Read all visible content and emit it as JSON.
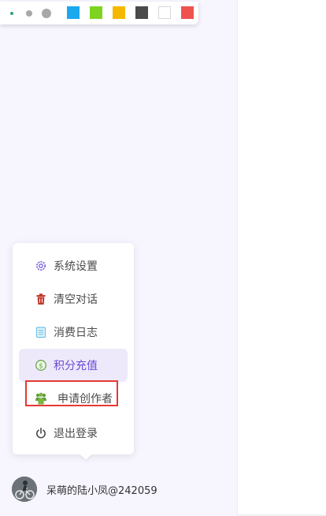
{
  "toolbar": {
    "sizes": [
      "small",
      "medium",
      "large"
    ],
    "colors": [
      "#1aa8ef",
      "#7ed321",
      "#f5b800",
      "#4a4a4a",
      "#ffffff",
      "#ef5350"
    ]
  },
  "menu": {
    "items": [
      {
        "label": "系统设置",
        "icon": "gear-icon"
      },
      {
        "label": "清空对话",
        "icon": "trash-icon"
      },
      {
        "label": "消费日志",
        "icon": "log-icon"
      },
      {
        "label": "积分充值",
        "icon": "coin-icon"
      },
      {
        "label": "申请创作者",
        "icon": "creator-icon"
      },
      {
        "label": "退出登录",
        "icon": "power-icon"
      }
    ]
  },
  "user": {
    "name": "呆萌的陆小凤@242059"
  },
  "colors": {
    "accent": "#6b48d8",
    "highlight_border": "#e53935"
  }
}
